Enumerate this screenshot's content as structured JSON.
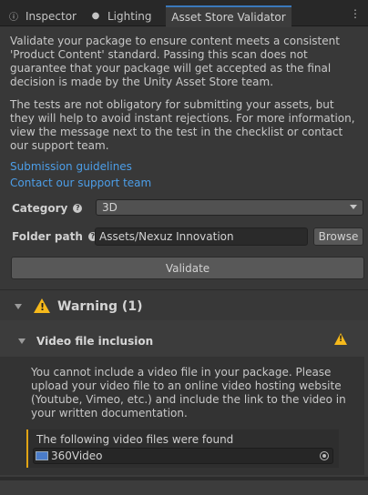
{
  "tabs": [
    {
      "label": "Inspector",
      "icon": "info-icon"
    },
    {
      "label": "Lighting",
      "icon": "lightbulb-icon"
    },
    {
      "label": "Asset Store Validator",
      "active": true
    }
  ],
  "intro": {
    "paragraph1": "Validate your package to ensure content meets a consistent 'Product Content' standard. Passing this scan does not guarantee that your package will get accepted as the final decision is made by the Unity Asset Store team.",
    "paragraph2": "The tests are not obligatory for submitting your assets, but they will help to avoid instant rejections. For more information, view the message next to the test in the checklist or contact our support team."
  },
  "links": {
    "submission_guidelines": "Submission guidelines",
    "contact_support": "Contact our support team"
  },
  "form": {
    "category_label": "Category",
    "category_value": "3D",
    "folder_label": "Folder path",
    "folder_value": "Assets/Nexuz Innovation",
    "browse_label": "Browse",
    "validate_label": "Validate"
  },
  "warning": {
    "header": "Warning (1)",
    "item_title": "Video file inclusion",
    "message": "You cannot include a video file in your package. Please upload your video file to an online video hosting website (Youtube, Vimeo, etc.) and include the link to the video in your written documentation.",
    "found_label": "The following video files were found",
    "file_name": "360Video"
  },
  "colors": {
    "accent_tab": "#3a79bb",
    "link": "#4c9ee8",
    "warning": "#f6b91b"
  }
}
